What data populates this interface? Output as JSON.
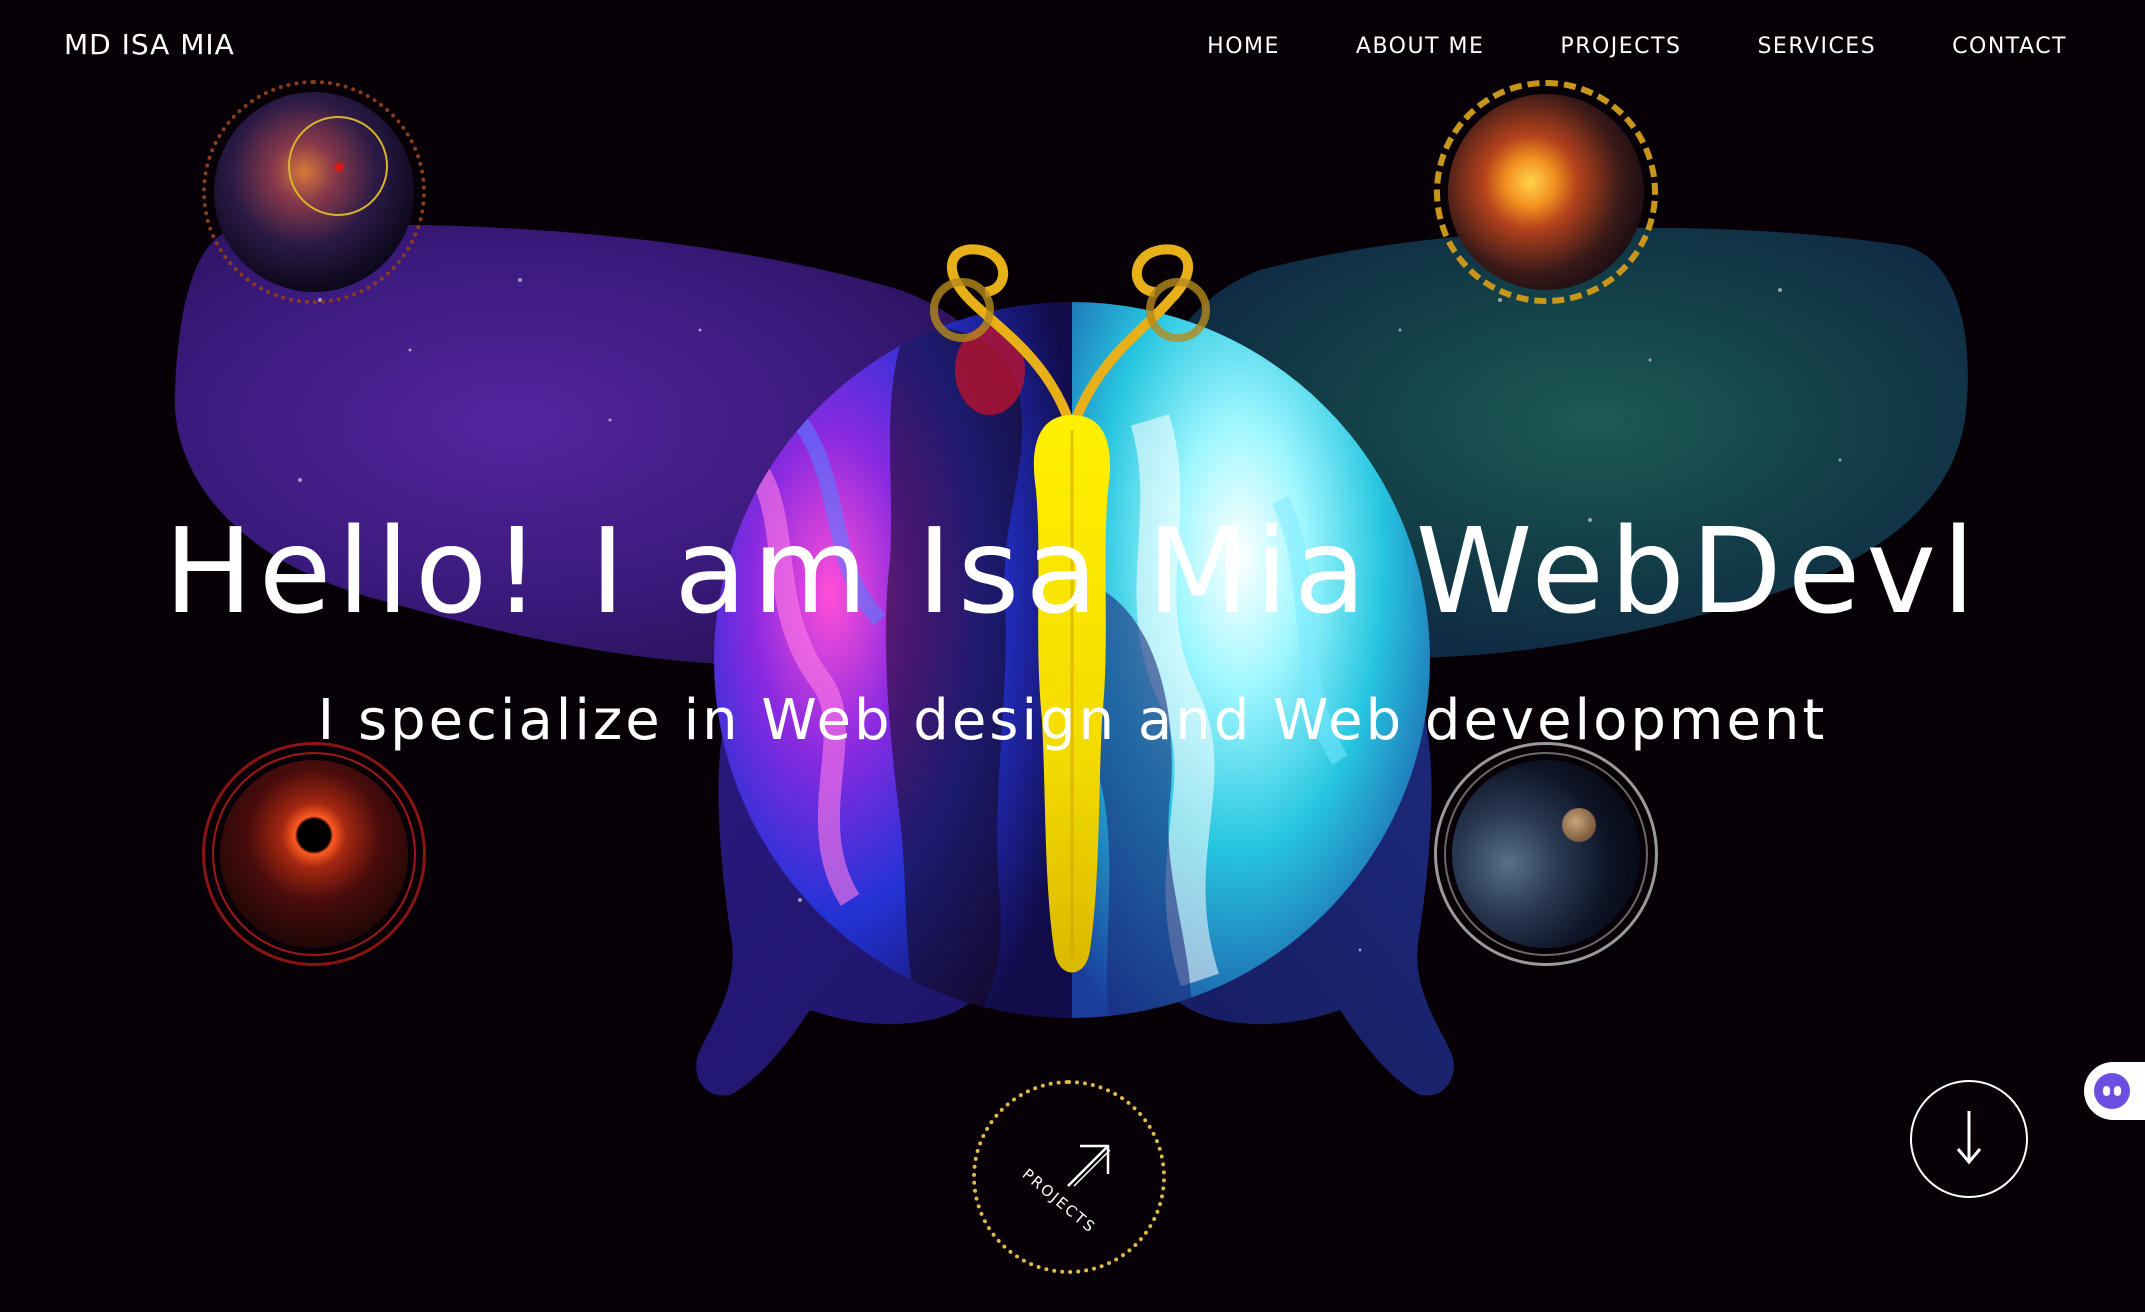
{
  "header": {
    "brand": "MD ISA MIA",
    "nav": [
      {
        "label": "HOME"
      },
      {
        "label": "ABOUT ME"
      },
      {
        "label": "PROJECTS"
      },
      {
        "label": "SERVICES"
      },
      {
        "label": "CONTACT"
      }
    ]
  },
  "hero": {
    "title": "Hello! I am Isa Mia WebDevl",
    "subtitle": "I specialize in Web design and Web development"
  },
  "badge": {
    "label": "PROJECTS",
    "icon": "arrow-up-right-icon",
    "ring_color": "#e2b84a"
  },
  "scroll": {
    "icon": "arrow-down-icon"
  },
  "chat": {
    "icon": "chatbot-face-icon",
    "color": "#6b4fe0"
  },
  "orbs": [
    {
      "name": "galaxy-orb",
      "ring_color": "#8a3d1d"
    },
    {
      "name": "sun-orb",
      "ring_color": "#c9961c"
    },
    {
      "name": "eclipse-orb",
      "ring_color": "#8a1414"
    },
    {
      "name": "planet-orb",
      "ring_color": "#9a9a9a"
    }
  ],
  "colors": {
    "background": "#070107",
    "left_wing": "#3a1878",
    "right_wing": "#0f3a3c",
    "body": "#ffee00"
  }
}
